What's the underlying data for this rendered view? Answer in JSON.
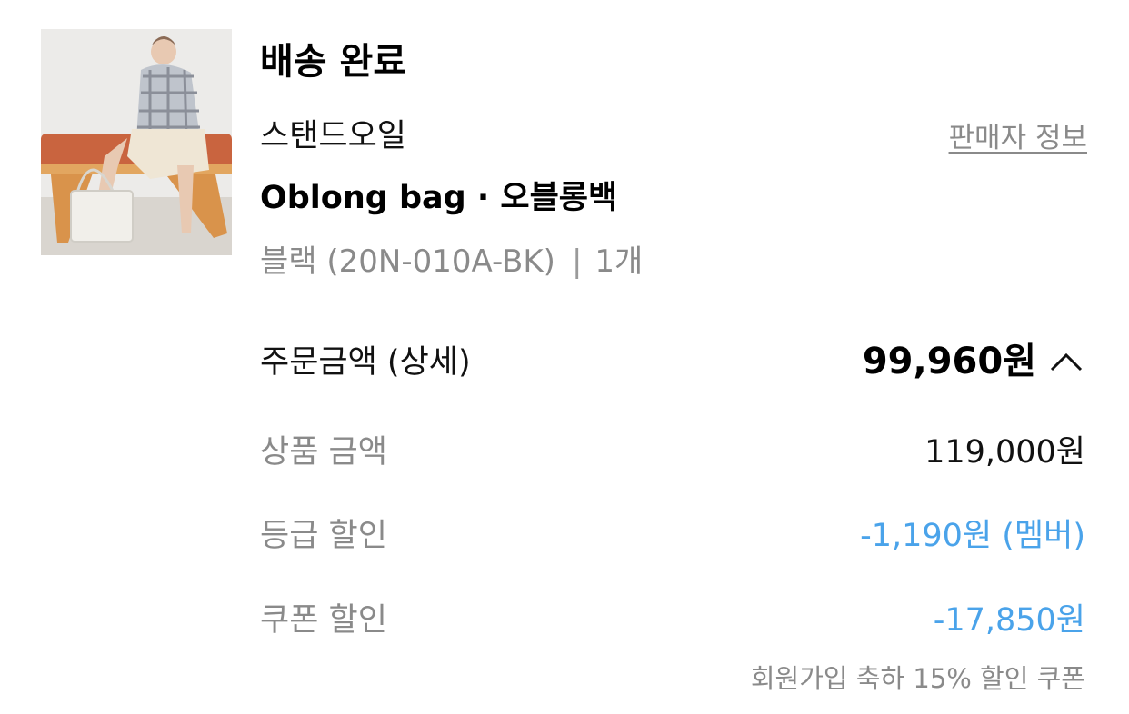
{
  "order": {
    "status": "배송 완료",
    "brand": "스탠드오일",
    "seller_link": "판매자 정보",
    "product_name": "Oblong bag · 오블롱백",
    "option": "블랙 (20N-010A-BK)",
    "quantity": "1개",
    "image_icon": "product-photo-icon"
  },
  "price": {
    "total_label": "주문금액 (상세)",
    "total_value": "99,960원",
    "toggle_icon": "chevron-up-icon",
    "rows": [
      {
        "label": "상품 금액",
        "value": "119,000원"
      },
      {
        "label": "등급 할인",
        "value": "-1,190원 (멤버)"
      },
      {
        "label": "쿠폰 할인",
        "value": "-17,850원",
        "note": "회원가입 축하 15% 할인 쿠폰"
      }
    ],
    "discount_color": "#4aa3ea"
  }
}
